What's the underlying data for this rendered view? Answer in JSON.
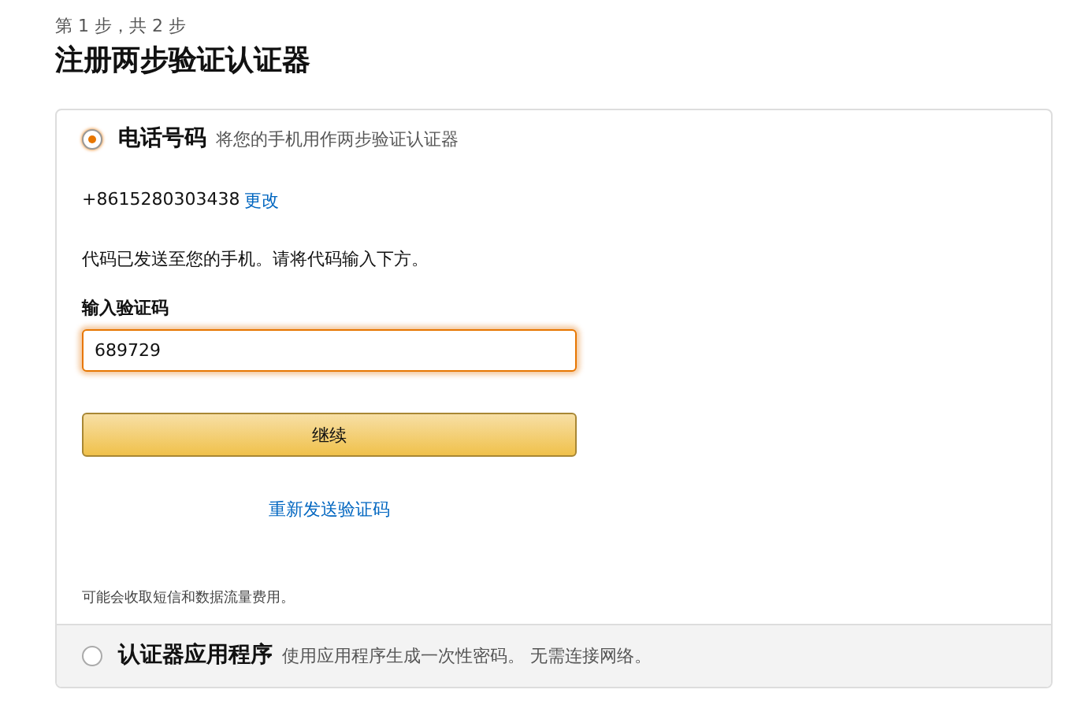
{
  "step": "第 1 步，共 2 步",
  "title": "注册两步验证认证器",
  "options": [
    {
      "title": "电话号码",
      "description": "将您的手机用作两步验证认证器",
      "selected": true,
      "phone": "+8615280303438",
      "change_link": "更改",
      "message": "代码已发送至您的手机。请将代码输入下方。",
      "field_label": "输入验证码",
      "code": "689729",
      "button": "继续",
      "resend_link": "重新发送验证码",
      "note": "可能会收取短信和数据流量费用。"
    },
    {
      "title": "认证器应用程序",
      "description": "使用应用程序生成一次性密码。 无需连接网络。",
      "selected": false
    }
  ]
}
